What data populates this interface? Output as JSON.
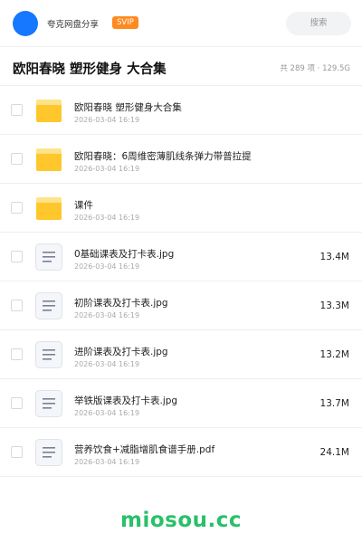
{
  "header": {
    "brand": "夸克网盘分享",
    "badge": "SVIP",
    "search_label": "搜索"
  },
  "folder": {
    "title": "欧阳春晓 塑形健身 大合集",
    "meta": "共 289 项 · 129.5G"
  },
  "items": [
    {
      "type": "folder",
      "name": "欧阳春晓 塑形健身大合集",
      "date": "2026-03-04 16:19",
      "size": ""
    },
    {
      "type": "folder",
      "name": "欧阳春晓：6周维密薄肌线条弹力带普拉提",
      "date": "2026-03-04 16:19",
      "size": ""
    },
    {
      "type": "folder",
      "name": "课件",
      "date": "2026-03-04 16:19",
      "size": ""
    },
    {
      "type": "file",
      "name": "0基础课表及打卡表.jpg",
      "date": "2026-03-04 16:19",
      "size": "13.4M"
    },
    {
      "type": "file",
      "name": "初阶课表及打卡表.jpg",
      "date": "2026-03-04 16:19",
      "size": "13.3M"
    },
    {
      "type": "file",
      "name": "进阶课表及打卡表.jpg",
      "date": "2026-03-04 16:19",
      "size": "13.2M"
    },
    {
      "type": "file",
      "name": "举铁版课表及打卡表.jpg",
      "date": "2026-03-04 16:19",
      "size": "13.7M"
    },
    {
      "type": "file",
      "name": "营养饮食+减脂增肌食谱手册.pdf",
      "date": "2026-03-04 16:19",
      "size": "24.1M"
    }
  ],
  "icons": {
    "folder": "folder-icon",
    "file": "document-icon"
  },
  "colors": {
    "accent": "#1677ff",
    "badge": "#ff8a1f",
    "folder": "#ffc72c",
    "watermark": "#29c06a"
  },
  "watermark": "miosou.cc"
}
